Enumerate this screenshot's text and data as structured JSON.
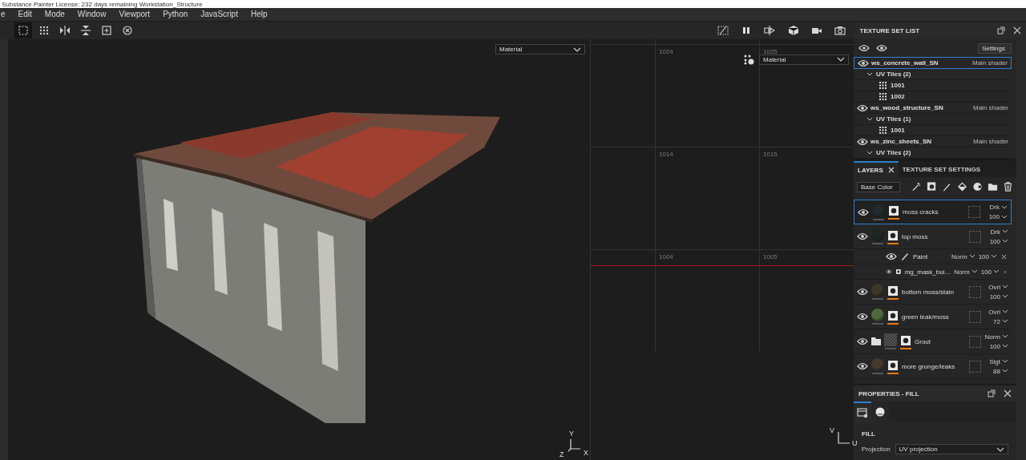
{
  "title_bar": {
    "text": "Substance Painter   License: 232 days remaining   Workstation_Structure"
  },
  "menu": [
    "e",
    "Edit",
    "Mode",
    "Window",
    "Viewport",
    "Python",
    "JavaScript",
    "Help"
  ],
  "toolbar": {
    "tools": [
      {
        "kind": "select",
        "selected": true
      },
      {
        "kind": "grid",
        "selected": false
      },
      {
        "kind": "mirror-x",
        "selected": false
      },
      {
        "kind": "mirror-y",
        "selected": false
      },
      {
        "kind": "add",
        "selected": false
      },
      {
        "kind": "reset",
        "selected": false
      }
    ],
    "view_tools": [
      {
        "kind": "hide"
      },
      {
        "kind": "pause"
      },
      {
        "kind": "split"
      },
      {
        "kind": "cube"
      },
      {
        "kind": "camera"
      },
      {
        "kind": "snapshot"
      }
    ]
  },
  "viewport_3d": {
    "channel": "Material",
    "axes": [
      "Y",
      "X",
      "Z"
    ]
  },
  "viewport_2d": {
    "channel": "Material",
    "tile_labels": [
      [
        "1024",
        "1025"
      ],
      [
        "1014",
        "1015"
      ],
      [
        "1004",
        "1005"
      ]
    ],
    "axes": [
      "V",
      "U"
    ]
  },
  "texture_set_list": {
    "title": "TEXTURE SET LIST",
    "settings": "Settings",
    "sets": [
      {
        "name": "ws_concrete_wall_SN",
        "shader": "Main shader",
        "selected": true,
        "group": {
          "label": "UV Tiles (2)",
          "expanded": true,
          "tiles": [
            "1001",
            "1002"
          ]
        }
      },
      {
        "name": "ws_wood_structure_SN",
        "shader": "Main shader",
        "selected": false,
        "group": {
          "label": "UV Tiles (1)",
          "expanded": true,
          "tiles": [
            "1001"
          ]
        }
      },
      {
        "name": "ws_zinc_sheets_SN",
        "shader": "Main shader",
        "selected": false,
        "group": {
          "label": "UV Tiles (2)",
          "expanded": true
        }
      }
    ]
  },
  "layers_panel": {
    "tabs": [
      {
        "label": "LAYERS",
        "selected": true
      },
      {
        "label": "TEXTURE SET SETTINGS",
        "selected": false
      }
    ],
    "channel": "Base Color",
    "layers": [
      {
        "kind": "layer",
        "name": "moss cracks",
        "blend": "Drk",
        "opacity": "100",
        "selected": true,
        "color": "#1f2b2c"
      },
      {
        "kind": "layer",
        "name": "top moss",
        "blend": "Drk",
        "opacity": "100",
        "selected": false,
        "color": "#1e2624",
        "children": [
          {
            "kind": "paint",
            "name": "Paint",
            "blend": "Norm",
            "opacity": "100"
          },
          {
            "kind": "mask",
            "name": "mg_mask_bui...",
            "blend": "Norm",
            "opacity": "100"
          }
        ]
      },
      {
        "kind": "layer",
        "name": "bottom moss/stain",
        "blend": "Ovrl",
        "opacity": "100",
        "selected": false,
        "color": "#3d3628"
      },
      {
        "kind": "layer",
        "name": "green leak/moss",
        "blend": "Ovrl",
        "opacity": "72",
        "selected": false,
        "color": "#4e6a3a"
      },
      {
        "kind": "folder",
        "name": "Grout",
        "blend": "Norm",
        "opacity": "100",
        "selected": false
      },
      {
        "kind": "layer",
        "name": "more grunge/leaks",
        "blend": "Slgt",
        "opacity": "88",
        "selected": false,
        "color": "#44392a"
      }
    ]
  },
  "properties": {
    "title": "PROPERTIES - FILL",
    "tabs": [
      {
        "kind": "settings",
        "selected": true
      },
      {
        "kind": "material",
        "selected": false
      }
    ],
    "section": "FILL",
    "fields": [
      {
        "label": "Projection",
        "value": "UV projection"
      }
    ]
  }
}
